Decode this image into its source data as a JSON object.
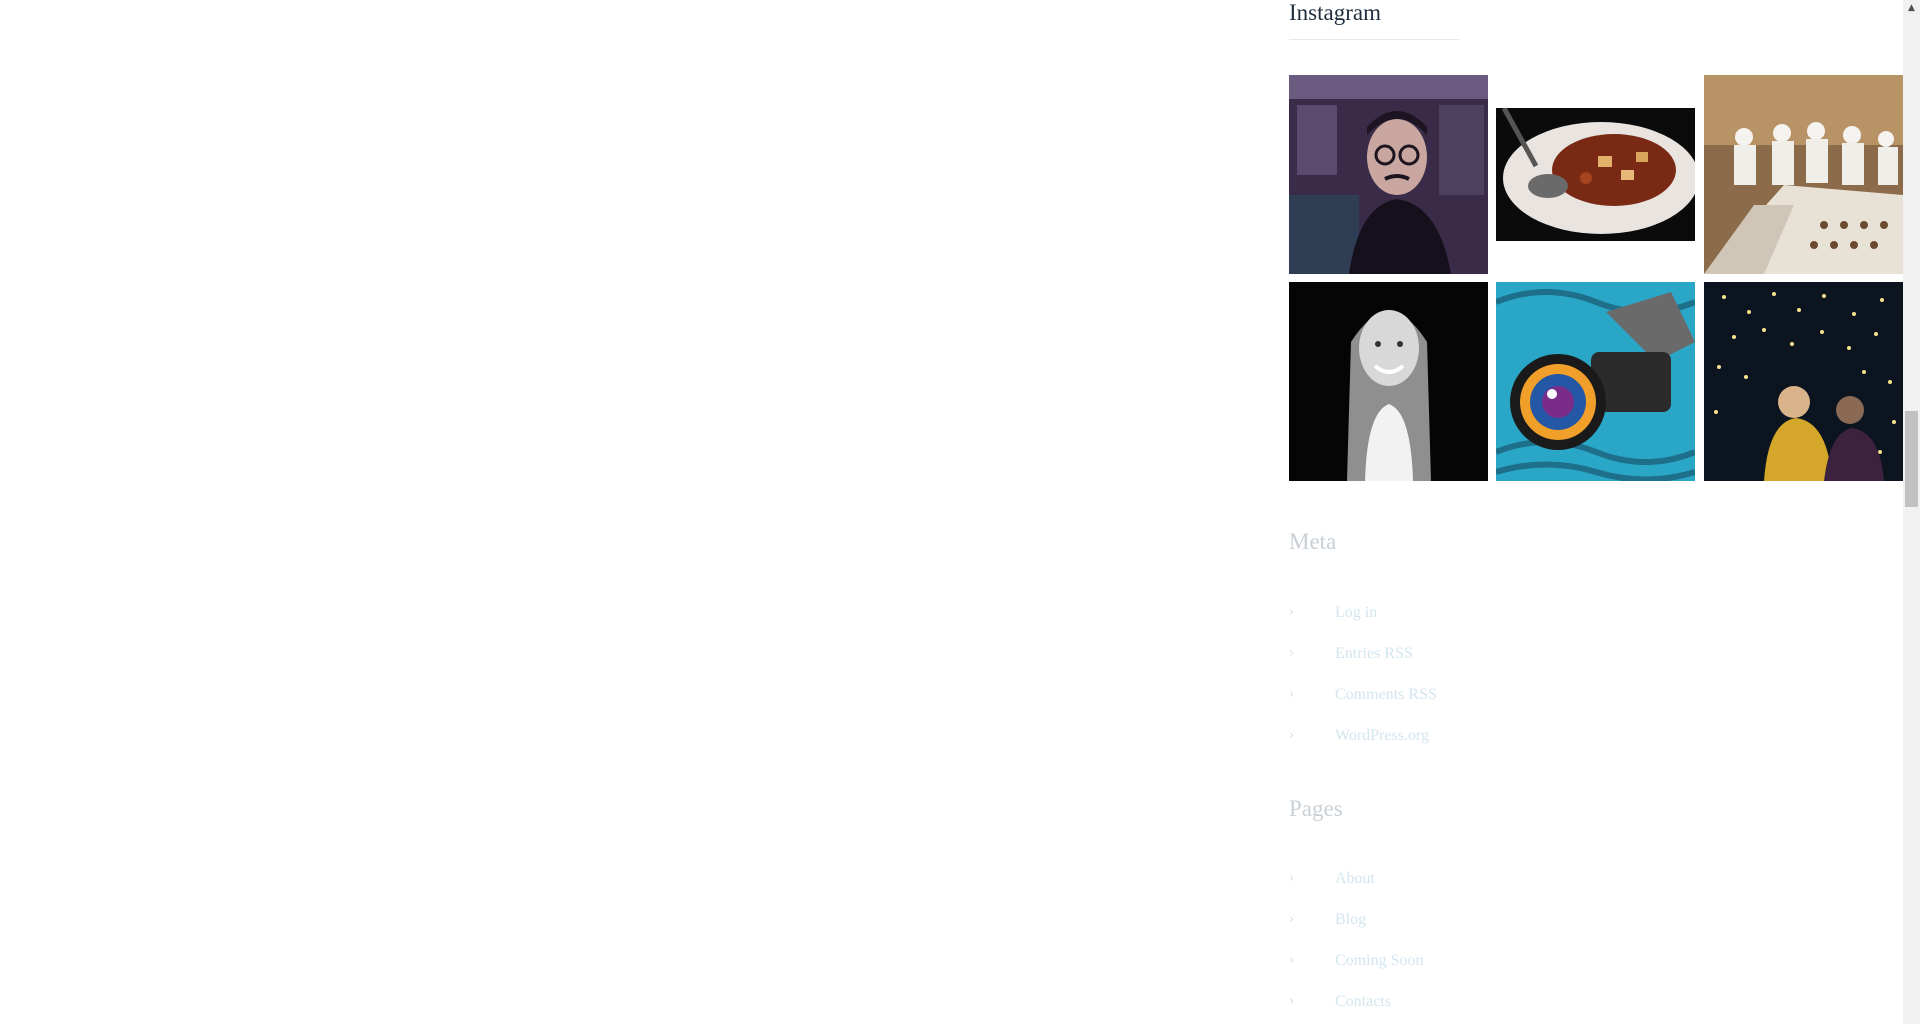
{
  "instagram": {
    "title": "Instagram",
    "photos": [
      {
        "label": "man with glasses and mustache selfie"
      },
      {
        "label": "plate of food with spoon"
      },
      {
        "label": "chefs at long banquet table"
      },
      {
        "label": "black and white portrait of smiling woman"
      },
      {
        "label": "camera lens on colorful fabric"
      },
      {
        "label": "people under string lights at night"
      }
    ]
  },
  "meta": {
    "title": "Meta",
    "links": [
      {
        "label": "Log in"
      },
      {
        "label": "Entries RSS"
      },
      {
        "label": "Comments RSS"
      },
      {
        "label": "WordPress.org"
      }
    ]
  },
  "pages": {
    "title": "Pages",
    "links": [
      {
        "label": "About"
      },
      {
        "label": "Blog"
      },
      {
        "label": "Coming Soon"
      },
      {
        "label": "Contacts"
      }
    ]
  },
  "icons": {
    "list_bullet": "chevron-right-icon",
    "scroll_up": "triangle-up-icon"
  },
  "colors": {
    "heading": "#1f2d3d",
    "faded_heading": "#c9cfd6",
    "faded_link": "#d3e6ef"
  }
}
